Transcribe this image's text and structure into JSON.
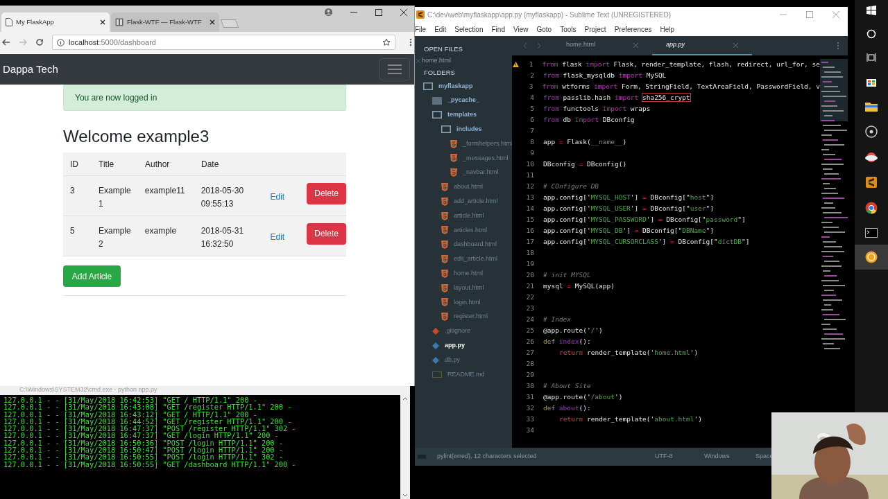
{
  "browser": {
    "tabs": [
      {
        "label": "My FlaskApp",
        "selected": true
      },
      {
        "label": "Flask-WTF — Flask-WTF",
        "selected": false
      }
    ],
    "url_host": "localhost",
    "url_rest": ":5000/dashboard",
    "brand": "Dappa Tech",
    "alert": "You are now logged in",
    "heading": "Welcome example3",
    "table": {
      "columns": [
        "ID",
        "Title",
        "Author",
        "Date"
      ],
      "rows": [
        {
          "id": "3",
          "title": "Example 1",
          "author": "example11",
          "date": "2018-05-30 09:55:13",
          "edit": "Edit",
          "delete": "Delete"
        },
        {
          "id": "5",
          "title": "Example 2",
          "author": "example",
          "date": "2018-05-31 16:32:50",
          "edit": "Edit",
          "delete": "Delete"
        }
      ]
    },
    "add_button": "Add Article"
  },
  "terminal": {
    "title": "C:\\Windows\\SYSTEM32\\cmd.exe - python  app.py",
    "lines": [
      "127.0.0.1 - - [31/May/2018 16:42:53] \"GET / HTTP/1.1\" 200 -",
      "127.0.0.1 - - [31/May/2018 16:43:08] \"GET /register HTTP/1.1\" 200 -",
      "127.0.0.1 - - [31/May/2018 16:43:12] \"GET / HTTP/1.1\" 200 -",
      "127.0.0.1 - - [31/May/2018 16:44:52] \"GET /register HTTP/1.1\" 200 -",
      "127.0.0.1 - - [31/May/2018 16:47:37] \"POST /register HTTP/1.1\" 302 -",
      "127.0.0.1 - - [31/May/2018 16:47:37] \"GET /login HTTP/1.1\" 200 -",
      "127.0.0.1 - - [31/May/2018 16:50:36] \"POST /login HTTP/1.1\" 200 -",
      "127.0.0.1 - - [31/May/2018 16:50:47] \"POST /login HTTP/1.1\" 200 -",
      "127.0.0.1 - - [31/May/2018 16:50:55] \"POST /login HTTP/1.1\" 302 -",
      "127.0.0.1 - - [31/May/2018 16:50:55] \"GET /dashboard HTTP/1.1\" 200 -"
    ]
  },
  "editor": {
    "title": "C:\\dev\\web\\myflaskapp\\app.py (myflaskapp) - Sublime Text (UNREGISTERED)",
    "menu": [
      "File",
      "Edit",
      "Selection",
      "Find",
      "View",
      "Goto",
      "Tools",
      "Project",
      "Preferences",
      "Help"
    ],
    "open_files_heading": "OPEN FILES",
    "open_files": [
      "home.html"
    ],
    "folders_heading": "FOLDERS",
    "tree": [
      {
        "kind": "folder",
        "name": "myflaskapp",
        "selected": false,
        "children": [
          {
            "kind": "folder-filled",
            "name": "_pycache_",
            "selected": false
          },
          {
            "kind": "folder",
            "name": "templates",
            "selected": false,
            "children": [
              {
                "kind": "folder",
                "name": "includes",
                "selected": false,
                "children": [
                  {
                    "kind": "html",
                    "name": "_formhelpers.html",
                    "selected": false
                  },
                  {
                    "kind": "html",
                    "name": "_messages.html",
                    "selected": false
                  },
                  {
                    "kind": "html",
                    "name": "_navbar.html",
                    "selected": false
                  }
                ]
              },
              {
                "kind": "html",
                "name": "about.html",
                "selected": false
              },
              {
                "kind": "html",
                "name": "add_article.html",
                "selected": false
              },
              {
                "kind": "html",
                "name": "article.html",
                "selected": false
              },
              {
                "kind": "html",
                "name": "articles.html",
                "selected": false
              },
              {
                "kind": "html",
                "name": "dashboard.html",
                "selected": false
              },
              {
                "kind": "html",
                "name": "edit_article.html",
                "selected": false
              },
              {
                "kind": "html",
                "name": "home.html",
                "selected": false
              },
              {
                "kind": "html",
                "name": "layout.html",
                "selected": false
              },
              {
                "kind": "html",
                "name": "login.html",
                "selected": false
              },
              {
                "kind": "html",
                "name": "register.html",
                "selected": false
              }
            ]
          },
          {
            "kind": "git",
            "name": ".gitignore",
            "selected": false
          },
          {
            "kind": "python",
            "name": "app.py",
            "selected": true
          },
          {
            "kind": "python",
            "name": "db.py",
            "selected": false
          },
          {
            "kind": "markdown",
            "name": "README.md",
            "selected": false
          }
        ]
      }
    ],
    "tabs": [
      {
        "label": "home.html",
        "selected": false
      },
      {
        "label": "app.py",
        "selected": true
      }
    ],
    "lines": [
      {
        "number": "1",
        "warning": true,
        "tokens": [
          {
            "kind": "keyword",
            "text": "from"
          },
          {
            "kind": "plain",
            "text": " flask "
          },
          {
            "kind": "keyword",
            "text": "import"
          },
          {
            "kind": "plain",
            "text": " Flask, render_template, flash, redirect, url_for, se"
          }
        ]
      },
      {
        "number": "2",
        "tokens": [
          {
            "kind": "keyword",
            "text": "from"
          },
          {
            "kind": "plain",
            "text": " flask_mysqldb "
          },
          {
            "kind": "keyword",
            "text": "import"
          },
          {
            "kind": "plain",
            "text": " MySQL"
          }
        ]
      },
      {
        "number": "3",
        "tokens": [
          {
            "kind": "keyword",
            "text": "from"
          },
          {
            "kind": "plain",
            "text": " wtforms "
          },
          {
            "kind": "keyword",
            "text": "import"
          },
          {
            "kind": "plain",
            "text": " Form, StringField, TextAreaField, PasswordField, v"
          }
        ]
      },
      {
        "number": "4",
        "tokens": [
          {
            "kind": "keyword",
            "text": "from"
          },
          {
            "kind": "plain",
            "text": " passlib.hash "
          },
          {
            "kind": "keyword",
            "text": "import"
          },
          {
            "kind": "boxed",
            "text": "sha256_crypt"
          }
        ]
      },
      {
        "number": "5",
        "tokens": [
          {
            "kind": "keyword",
            "text": "from"
          },
          {
            "kind": "plain",
            "text": " functools "
          },
          {
            "kind": "keyword",
            "text": "import"
          },
          {
            "kind": "plain",
            "text": " wraps"
          }
        ]
      },
      {
        "number": "6",
        "tokens": [
          {
            "kind": "keyword",
            "text": "from"
          },
          {
            "kind": "plain",
            "text": " db "
          },
          {
            "kind": "keyword",
            "text": "import"
          },
          {
            "kind": "plain",
            "text": " DBconfig"
          }
        ]
      },
      {
        "number": "7"
      },
      {
        "number": "8",
        "tokens": [
          {
            "kind": "plain",
            "text": "app "
          },
          {
            "kind": "operator",
            "text": "="
          },
          {
            "kind": "plain",
            "text": " Flask("
          },
          {
            "kind": "builtin",
            "text": "__name__"
          },
          {
            "kind": "plain",
            "text": ")"
          }
        ]
      },
      {
        "number": "9"
      },
      {
        "number": "10",
        "tokens": [
          {
            "kind": "plain",
            "text": "DBconfig "
          },
          {
            "kind": "operator",
            "text": "="
          },
          {
            "kind": "plain",
            "text": " DBconfig()"
          }
        ]
      },
      {
        "number": "11"
      },
      {
        "number": "12",
        "tokens": [
          {
            "kind": "comment",
            "text": "# COnfigure DB"
          }
        ]
      },
      {
        "number": "13",
        "tokens": [
          {
            "kind": "plain",
            "text": "app.config['"
          },
          {
            "kind": "string",
            "text": "MYSQL_HOST"
          },
          {
            "kind": "plain",
            "text": "'] "
          },
          {
            "kind": "operator",
            "text": "="
          },
          {
            "kind": "plain",
            "text": " DBconfig[\""
          },
          {
            "kind": "string",
            "text": "host"
          },
          {
            "kind": "plain",
            "text": "\"]"
          }
        ]
      },
      {
        "number": "14",
        "tokens": [
          {
            "kind": "plain",
            "text": "app.config['"
          },
          {
            "kind": "string",
            "text": "MYSQL_USER"
          },
          {
            "kind": "plain",
            "text": "'] "
          },
          {
            "kind": "operator",
            "text": "="
          },
          {
            "kind": "plain",
            "text": " DBconfig[\""
          },
          {
            "kind": "string",
            "text": "user"
          },
          {
            "kind": "plain",
            "text": "\"]"
          }
        ]
      },
      {
        "number": "15",
        "tokens": [
          {
            "kind": "plain",
            "text": "app.config['"
          },
          {
            "kind": "string",
            "text": "MYSQL_PASSWORD"
          },
          {
            "kind": "plain",
            "text": "'] "
          },
          {
            "kind": "operator",
            "text": "="
          },
          {
            "kind": "plain",
            "text": " DBconfig[\""
          },
          {
            "kind": "string",
            "text": "password"
          },
          {
            "kind": "plain",
            "text": "\"]"
          }
        ]
      },
      {
        "number": "16",
        "tokens": [
          {
            "kind": "plain",
            "text": "app.config['"
          },
          {
            "kind": "string",
            "text": "MYSQL_DB"
          },
          {
            "kind": "plain",
            "text": "'] "
          },
          {
            "kind": "operator",
            "text": "="
          },
          {
            "kind": "plain",
            "text": " DBconfig[\""
          },
          {
            "kind": "string",
            "text": "DBName"
          },
          {
            "kind": "plain",
            "text": "\"]"
          }
        ]
      },
      {
        "number": "17",
        "tokens": [
          {
            "kind": "plain",
            "text": "app.config['"
          },
          {
            "kind": "string",
            "text": "MYSQL_CURSORCLASS"
          },
          {
            "kind": "plain",
            "text": "'] "
          },
          {
            "kind": "operator",
            "text": "="
          },
          {
            "kind": "plain",
            "text": " DBconfig[\""
          },
          {
            "kind": "string",
            "text": "dictDB"
          },
          {
            "kind": "plain",
            "text": "\"]"
          }
        ]
      },
      {
        "number": "18"
      },
      {
        "number": "19"
      },
      {
        "number": "20",
        "tokens": [
          {
            "kind": "comment",
            "text": "# init MYSQL"
          }
        ]
      },
      {
        "number": "21",
        "tokens": [
          {
            "kind": "plain",
            "text": "mysql "
          },
          {
            "kind": "operator",
            "text": "="
          },
          {
            "kind": "plain",
            "text": " MySQL(app)"
          }
        ]
      },
      {
        "number": "22"
      },
      {
        "number": "23"
      },
      {
        "number": "24",
        "tokens": [
          {
            "kind": "comment",
            "text": "# Index"
          }
        ]
      },
      {
        "number": "25",
        "tokens": [
          {
            "kind": "plain",
            "text": "@app.route('"
          },
          {
            "kind": "string",
            "text": "/"
          },
          {
            "kind": "plain",
            "text": "')"
          }
        ]
      },
      {
        "number": "26",
        "tokens": [
          {
            "kind": "storage",
            "text": "def"
          },
          {
            "kind": "function",
            "text": "index"
          },
          {
            "kind": "plain",
            "text": "():"
          }
        ]
      },
      {
        "number": "27",
        "indented": true,
        "tokens": [
          {
            "kind": "control",
            "text": "return"
          },
          {
            "kind": "plain",
            "text": " render_template('"
          },
          {
            "kind": "string",
            "text": "home.html"
          },
          {
            "kind": "plain",
            "text": "')"
          }
        ]
      },
      {
        "number": "28"
      },
      {
        "number": "29"
      },
      {
        "number": "30",
        "tokens": [
          {
            "kind": "comment",
            "text": "# About Site"
          }
        ]
      },
      {
        "number": "31",
        "tokens": [
          {
            "kind": "plain",
            "text": "@app.route('"
          },
          {
            "kind": "string",
            "text": "/about"
          },
          {
            "kind": "plain",
            "text": "')"
          }
        ]
      },
      {
        "number": "32",
        "tokens": [
          {
            "kind": "storage",
            "text": "def"
          },
          {
            "kind": "function",
            "text": "about"
          },
          {
            "kind": "plain",
            "text": "():"
          }
        ]
      },
      {
        "number": "33",
        "indented": true,
        "tokens": [
          {
            "kind": "control",
            "text": "return"
          },
          {
            "kind": "plain",
            "text": " render_template('"
          },
          {
            "kind": "string",
            "text": "about.html"
          },
          {
            "kind": "plain",
            "text": "')"
          }
        ]
      },
      {
        "number": "34"
      }
    ],
    "status": {
      "message": "pylint(erred), 12 characters selected",
      "encoding": "UTF-8",
      "line_endings": "Windows",
      "indent": "Space"
    }
  }
}
